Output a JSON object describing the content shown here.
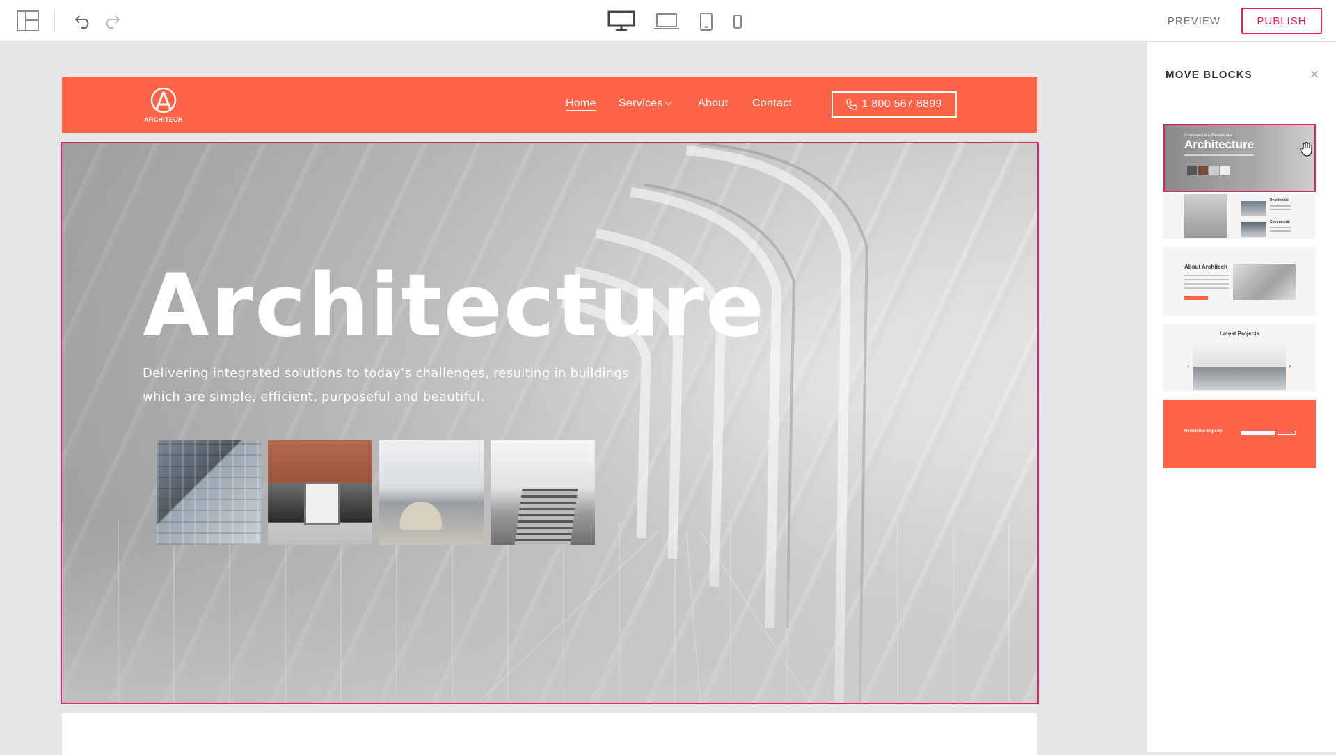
{
  "toolbar": {
    "preview_label": "PREVIEW",
    "publish_label": "PUBLISH",
    "accent_color": "#e91e63",
    "icons": [
      "layout-icon",
      "undo-icon",
      "redo-icon",
      "desktop-icon",
      "laptop-icon",
      "tablet-icon",
      "phone-icon"
    ]
  },
  "site": {
    "brand_color": "#ff6347",
    "logo_text": "ARCHITECH",
    "nav": {
      "home": "Home",
      "services": "Services",
      "about": "About",
      "contact": "Contact"
    },
    "phone": "1 800 567 8899",
    "hero": {
      "title": "Architecture",
      "subtitle": "Delivering integrated solutions to today’s challenges, resulting in buildings which are simple, efficient, purposeful and beautiful."
    }
  },
  "panel": {
    "title": "MOVE BLOCKS",
    "blocks": {
      "hero": {
        "kicker": "Commercial & Residential",
        "title": "Architecture"
      },
      "services": {
        "label1": "Residential",
        "label2": "Commercial"
      },
      "about": {
        "title": "About Architech"
      },
      "projects": {
        "title": "Latest Projects",
        "prev": "‹",
        "next": "›"
      },
      "newsletter": {
        "title": "Newsletter Sign Up"
      }
    }
  }
}
